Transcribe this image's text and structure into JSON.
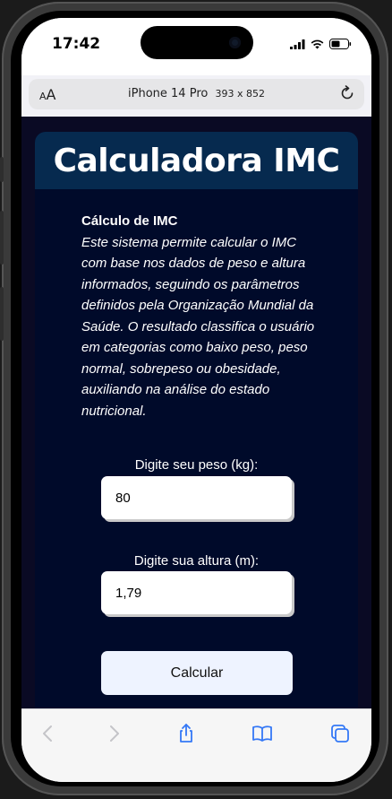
{
  "status_bar": {
    "time": "17:42"
  },
  "address_bar": {
    "text_size_label": "AA",
    "device_name": "iPhone 14 Pro",
    "dimensions": "393 x 852"
  },
  "app": {
    "title": "Calculadora IMC",
    "description_title": "Cálculo de IMC",
    "description_text": "Este sistema permite calcular o IMC com base nos dados de peso e altura informados, seguindo os parâmetros definidos pela Organização Mundial da Saúde. O resultado classifica o usuário em categorias como baixo peso, peso normal, sobrepeso ou obesidade, auxiliando na análise do estado nutricional.",
    "weight_label": "Digite seu peso (kg):",
    "weight_value": "80",
    "height_label": "Digite sua altura (m):",
    "height_value": "1,79",
    "calculate_label": "Calcular"
  },
  "colors": {
    "page_background": "#0a0a24",
    "card_background": "#000a2a",
    "header_background": "#062a4f",
    "button_background": "#eef3ff",
    "toolbar_accent": "#3478f6"
  },
  "icons": [
    "signal-icon",
    "wifi-icon",
    "battery-icon",
    "reload-icon",
    "back-icon",
    "forward-icon",
    "share-icon",
    "bookmarks-icon",
    "tabs-icon"
  ]
}
